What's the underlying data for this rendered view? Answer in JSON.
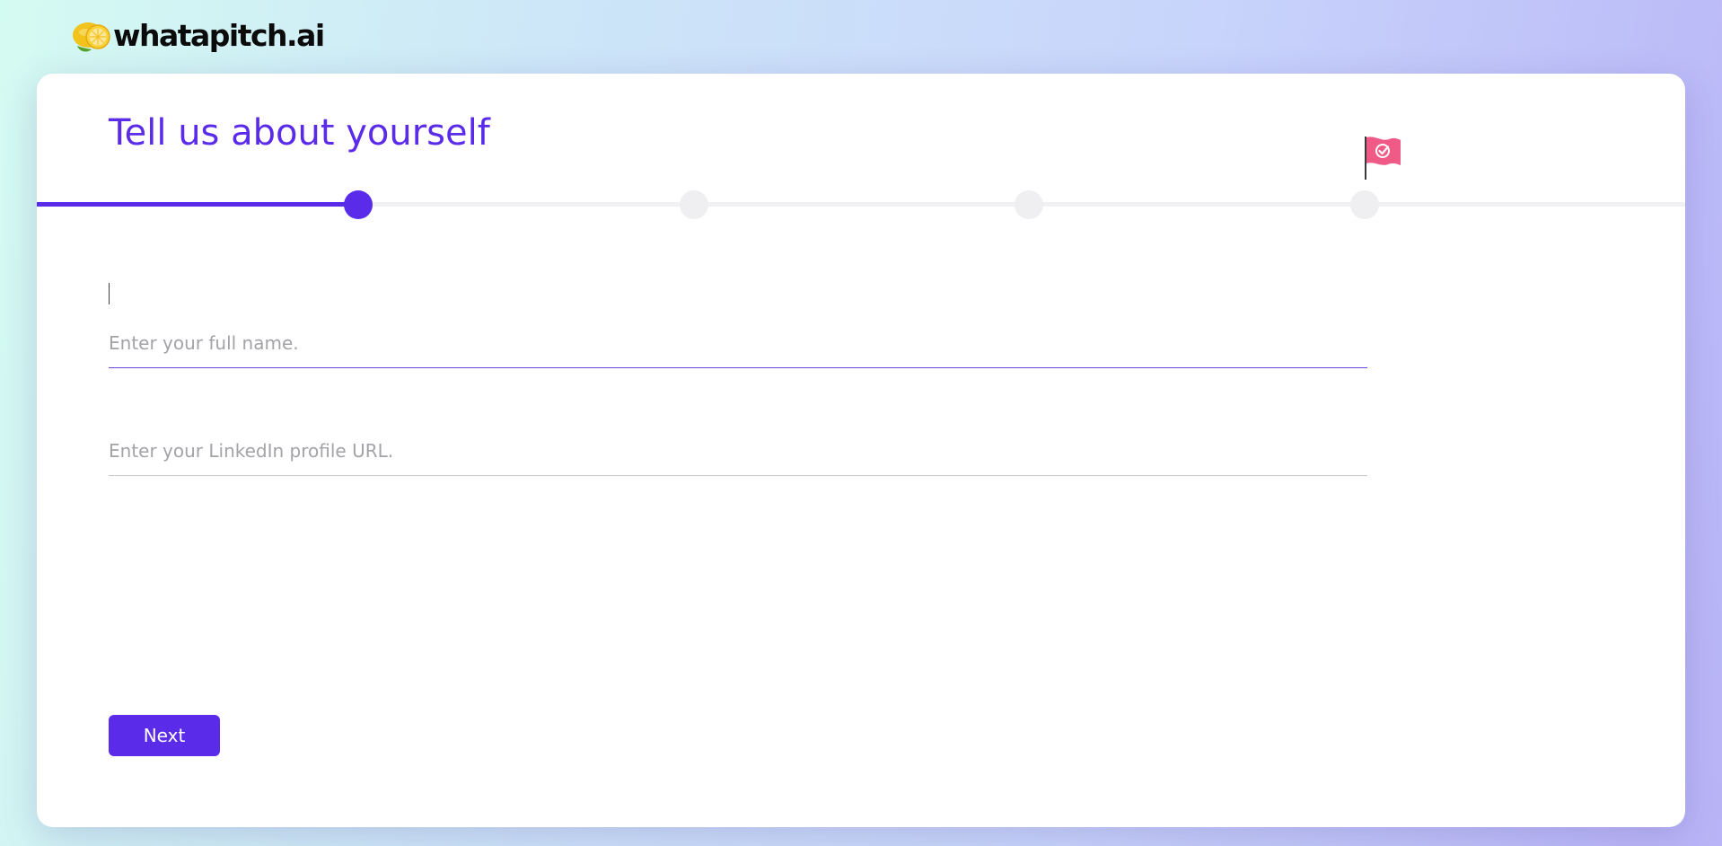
{
  "brand": {
    "name": "whatapitch.ai",
    "icon": "lemon-icon"
  },
  "header": {
    "title": "Tell us about yourself"
  },
  "progress": {
    "current_step": 1,
    "total_steps": 4,
    "finish_icon": "finish-flag-icon"
  },
  "form": {
    "full_name": {
      "placeholder": "Enter your full name.",
      "value": ""
    },
    "linkedin": {
      "placeholder": "Enter your LinkedIn profile URL.",
      "value": ""
    },
    "next_label": "Next"
  },
  "colors": {
    "accent": "#5b2bea",
    "flag": "#f05a86",
    "track": "#f1f1f3"
  }
}
